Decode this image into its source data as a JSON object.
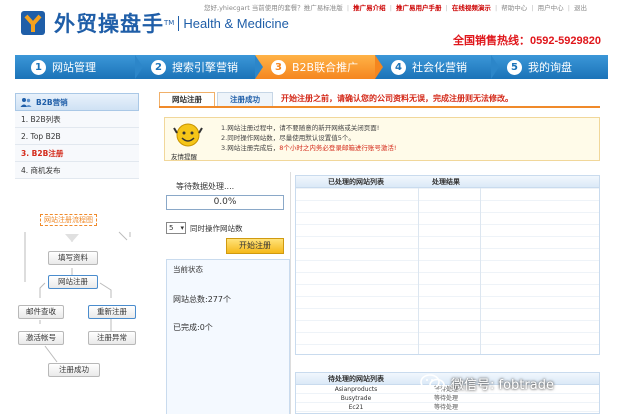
{
  "header": {
    "logo_text": "外贸操盘手",
    "logo_tm": "TM",
    "logo_sub": "Health & Medicine",
    "greeting": "您好,yhiecgart 当前使用的套餐？推广易标准版",
    "links": [
      "推广易介绍",
      "推广易用户手册",
      "在线视频演示",
      "帮助中心",
      "用户中心",
      "退出"
    ],
    "hotline": "全国销售热线：0592-5929820"
  },
  "steps": [
    {
      "num": "1",
      "label": "网站管理"
    },
    {
      "num": "2",
      "label": "搜索引擎营销"
    },
    {
      "num": "3",
      "label": "B2B联合推广"
    },
    {
      "num": "4",
      "label": "社会化营销"
    },
    {
      "num": "5",
      "label": "我的询盘"
    }
  ],
  "sidebar": {
    "title": "B2B营销",
    "items": [
      "1. B2B列表",
      "2. Top B2B",
      "3. B2B注册",
      "4. 商机发布"
    ]
  },
  "flow": {
    "title": "网站注册流程图",
    "fill": "填写资料",
    "register": "网站注册",
    "email": "邮件查收",
    "activate": "激活帐号",
    "reregister": "重新注册",
    "error": "注册异常",
    "success": "注册成功"
  },
  "tabs": {
    "active": "网站注册",
    "other": "注册成功",
    "warning": "开始注册之前，请确认您的公司资料无误，完成注册则无法修改。"
  },
  "notice": {
    "caption": "友情提醒",
    "line1": "1.网站注册过程中，请不要随意的新开网络或关闭页面!",
    "line2": "2.同时操作网站数，尽量使用默认设置值5个。",
    "line3_a": "3.网站注册完成后，",
    "line3_b": "8个小时之内务必登录邮箱进行账号激活!"
  },
  "panel": {
    "wait": "等待数据处理....",
    "percent": "0.0%",
    "count_value": "5",
    "count_label": "同时操作网站数",
    "start": "开始注册",
    "state_title": "当前状态",
    "total": "网站总数:277个",
    "done": "已完成:0个"
  },
  "table1": {
    "col1": "已处理的网站列表",
    "col2": "处理结果"
  },
  "table2": {
    "col1": "待处理的网站列表",
    "col2": "",
    "rows": [
      {
        "site": "Asianproducts",
        "status": "等待处理"
      },
      {
        "site": "Busytrade",
        "status": "等待处理"
      },
      {
        "site": "Ec21",
        "status": "等待处理"
      }
    ]
  },
  "watermark": "微信号: fobtrade"
}
